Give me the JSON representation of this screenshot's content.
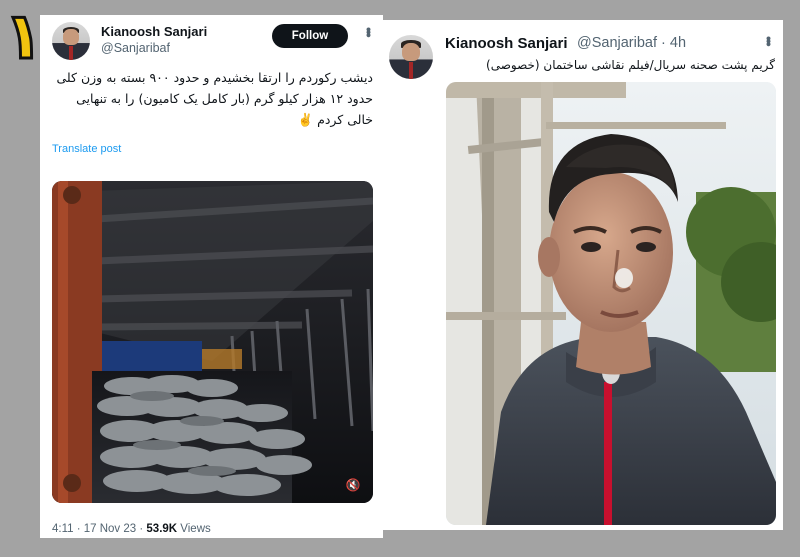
{
  "badge": "۱",
  "tweet_left": {
    "display_name": "Kianoosh Sanjari",
    "handle": "@Sanjaribaf",
    "follow_label": "Follow",
    "text": "دیشب رکوردم را ارتقا بخشیدم و حدود ۹۰۰ بسته به وزن کلی حدود ۱۲ هزار کیلو گرم (بار کامل یک کامیون) را به تنهایی خالی کردم ✌️",
    "translate_label": "Translate post",
    "time": "4:11 · 17 Nov 23 · ",
    "views": "53.9K",
    "views_label": " Views"
  },
  "tweet_right": {
    "display_name": "Kianoosh Sanjari",
    "handle": "@Sanjaribaf · 4h",
    "text": "گریم پشت صحنه سریال/فیلم نقاشی ساختمان (خصوصی)"
  },
  "icons": {
    "more": "more-options-icon",
    "mute": "speaker-muted-icon"
  },
  "colors": {
    "badge": "#f1c40f",
    "link": "#1d9bf0",
    "text_primary": "#0f1419",
    "text_secondary": "#536471",
    "jacket_zipper": "#c8102e"
  }
}
